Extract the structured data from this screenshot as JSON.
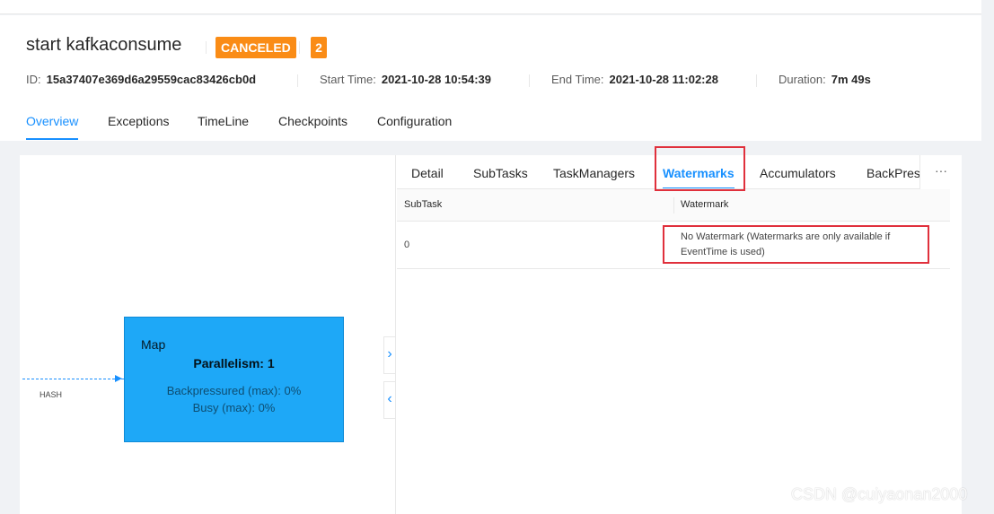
{
  "job": {
    "title": "start kafkaconsume",
    "status": "CANCELED",
    "task_count": "2",
    "id_label": "ID:",
    "id_value": "15a37407e369d6a29559cac83426cb0d",
    "start_label": "Start Time:",
    "start_value": "2021-10-28 10:54:39",
    "end_label": "End Time:",
    "end_value": "2021-10-28 11:02:28",
    "duration_label": "Duration:",
    "duration_value": "7m 49s"
  },
  "tabs": [
    "Overview",
    "Exceptions",
    "TimeLine",
    "Checkpoints",
    "Configuration"
  ],
  "active_tab": "Overview",
  "graph": {
    "node": {
      "name": "Map",
      "parallelism": "Parallelism: 1",
      "backpressured": "Backpressured (max): 0%",
      "busy": "Busy (max): 0%"
    },
    "edge_label": "HASH",
    "collapse_right_icon": "chevron-right-icon",
    "collapse_left_icon": "chevron-left-icon"
  },
  "detail": {
    "sub_tabs": [
      "Detail",
      "SubTasks",
      "TaskManagers",
      "Watermarks",
      "Accumulators",
      "BackPress"
    ],
    "active_sub_tab": "Watermarks",
    "more": "···",
    "table": {
      "columns": [
        "SubTask",
        "Watermark"
      ],
      "rows": [
        {
          "subtask": "0",
          "watermark_line1": "No Watermark (Watermarks are only available if",
          "watermark_line2": "EventTime is used)"
        }
      ]
    }
  },
  "colors": {
    "accent": "#1890ff",
    "status_canceled": "#fa8c16",
    "node_fill": "#1ea8f7",
    "highlight": "#e0303c"
  },
  "watermark_overlay": "CSDN @cuiyaonan2000"
}
